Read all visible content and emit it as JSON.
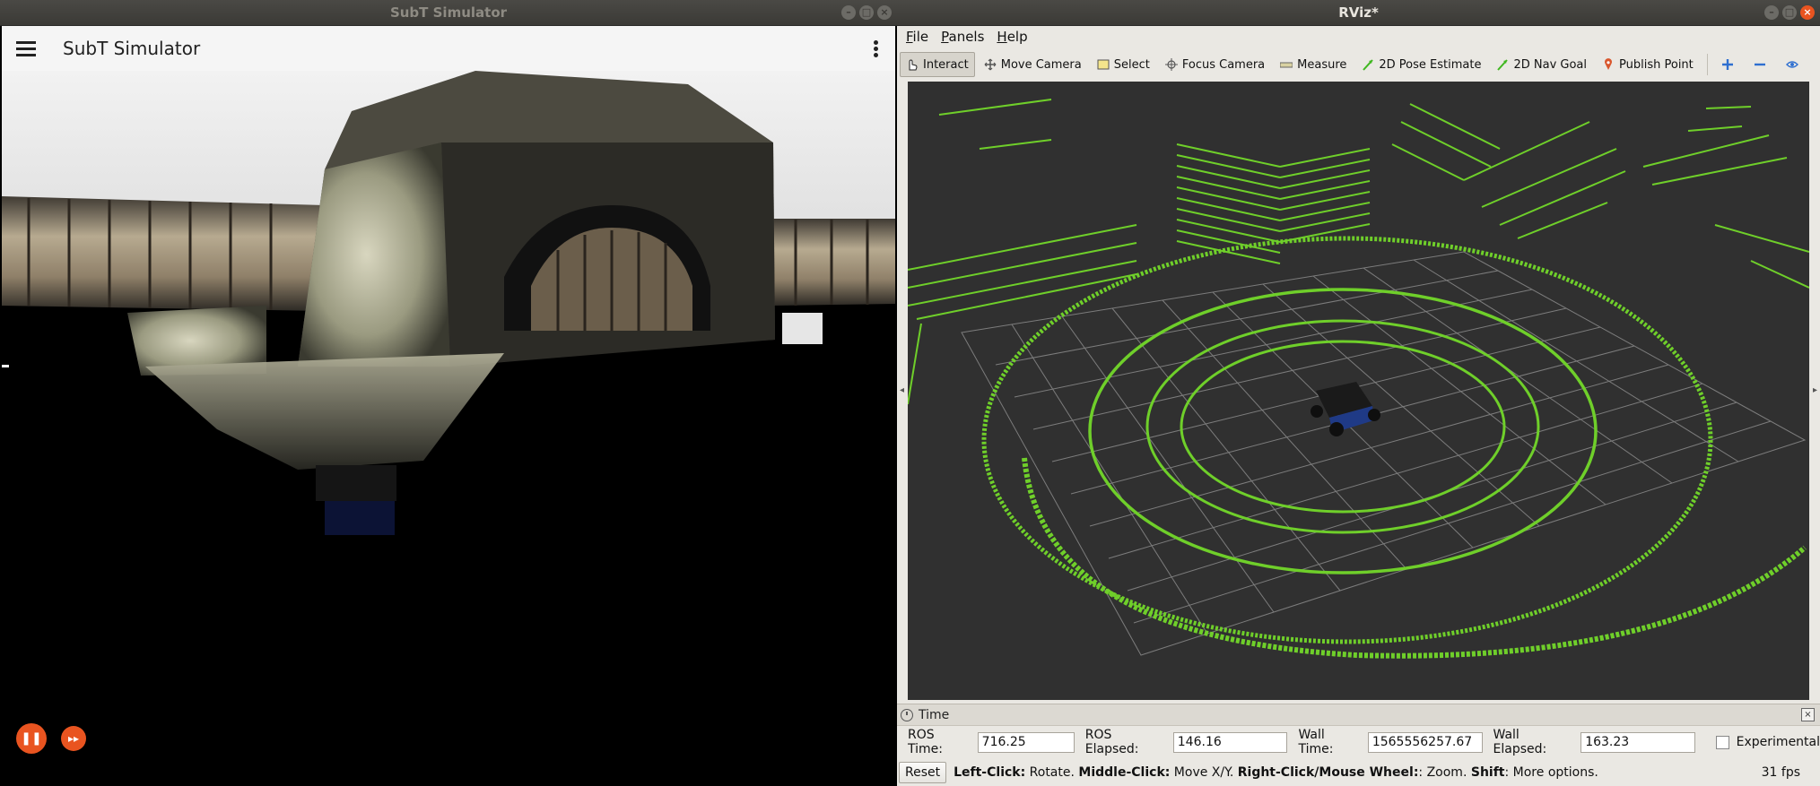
{
  "subt": {
    "window_title": "SubT Simulator",
    "appbar_title": "SubT Simulator",
    "controls": {
      "pause_glyph": "❚❚",
      "fastforward_glyph": "▸▸"
    }
  },
  "rviz": {
    "window_title": "RViz*",
    "menu": [
      "File",
      "Panels",
      "Help"
    ],
    "tools": [
      {
        "label": "Interact",
        "icon": "hand-pointer-icon",
        "active": true
      },
      {
        "label": "Move Camera",
        "icon": "move-arrows-icon",
        "active": false
      },
      {
        "label": "Select",
        "icon": "select-box-icon",
        "active": false
      },
      {
        "label": "Focus Camera",
        "icon": "focus-crosshair-icon",
        "active": false
      },
      {
        "label": "Measure",
        "icon": "ruler-icon",
        "active": false
      },
      {
        "label": "2D Pose Estimate",
        "icon": "green-arrow-icon",
        "active": false
      },
      {
        "label": "2D Nav Goal",
        "icon": "green-arrow-icon",
        "active": false
      },
      {
        "label": "Publish Point",
        "icon": "map-pin-icon",
        "active": false
      }
    ],
    "time_panel": {
      "title": "Time",
      "ros_time_label": "ROS Time:",
      "ros_time": "716.25",
      "ros_elapsed_label": "ROS Elapsed:",
      "ros_elapsed": "146.16",
      "wall_time_label": "Wall Time:",
      "wall_time": "1565556257.67",
      "wall_elapsed_label": "Wall Elapsed:",
      "wall_elapsed": "163.23",
      "experimental_label": "Experimental"
    },
    "status": {
      "reset_label": "Reset",
      "hint_left_click": "Left-Click:",
      "hint_rotate": " Rotate. ",
      "hint_middle_click": "Middle-Click:",
      "hint_move": " Move X/Y. ",
      "hint_right_click": "Right-Click/Mouse Wheel:",
      "hint_zoom": ": Zoom. ",
      "hint_shift": "Shift",
      "hint_more": ": More options.",
      "fps": "31 fps"
    },
    "colors": {
      "laser": "#6fcf2a",
      "grid": "#8a8a8a",
      "viewport_bg": "#303030"
    }
  }
}
